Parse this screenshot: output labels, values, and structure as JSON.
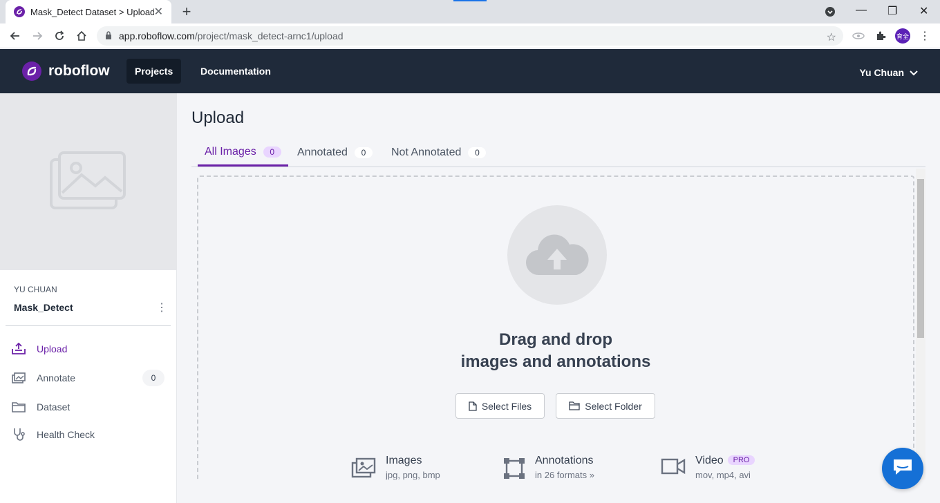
{
  "browser": {
    "tab_title": "Mask_Detect Dataset > Upload",
    "url_host": "app.roboflow.com",
    "url_path": "/project/mask_detect-arnc1/upload",
    "profile_initials": "育全"
  },
  "header": {
    "brand": "roboflow",
    "nav_projects": "Projects",
    "nav_docs": "Documentation",
    "user": "Yu Chuan"
  },
  "sidebar": {
    "owner": "YU CHUAN",
    "project": "Mask_Detect",
    "items": [
      {
        "label": "Upload",
        "icon": "upload-tray-icon",
        "active": true
      },
      {
        "label": "Annotate",
        "icon": "images-stack-icon",
        "count": "0"
      },
      {
        "label": "Dataset",
        "icon": "folder-icon"
      },
      {
        "label": "Health Check",
        "icon": "stethoscope-icon"
      }
    ]
  },
  "main": {
    "title": "Upload",
    "tabs": [
      {
        "label": "All Images",
        "count": "0"
      },
      {
        "label": "Annotated",
        "count": "0"
      },
      {
        "label": "Not Annotated",
        "count": "0"
      }
    ],
    "drop_line1": "Drag and drop",
    "drop_line2": "images and annotations",
    "select_files": "Select Files",
    "select_folder": "Select Folder",
    "formats": [
      {
        "title": "Images",
        "sub": "jpg, png, bmp"
      },
      {
        "title": "Annotations",
        "sub": "in 26 formats »"
      },
      {
        "title": "Video",
        "sub": "mov, mp4, avi",
        "badge": "PRO"
      }
    ]
  },
  "colors": {
    "accent": "#6b21a8",
    "header_bg": "#1f2a3a",
    "chat_button": "#1570d6"
  }
}
